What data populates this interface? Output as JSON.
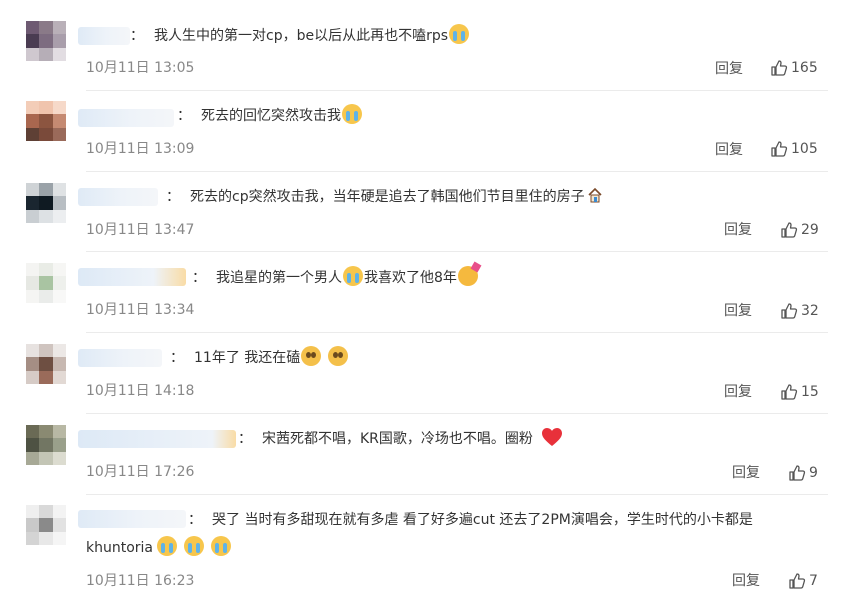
{
  "comments": [
    {
      "text": "我人生中的第一对cp，be以后从此再也不嗑rps",
      "time": "10月11日 13:05",
      "reply_label": "回复",
      "likes": "165"
    },
    {
      "text": "死去的回忆突然攻击我",
      "time": "10月11日 13:09",
      "reply_label": "回复",
      "likes": "105"
    },
    {
      "text": "死去的cp突然攻击我，当年硬是追去了韩国他们节目里住的房子",
      "time": "10月11日 13:47",
      "reply_label": "回复",
      "likes": "29"
    },
    {
      "text_a": "我追星的第一个男人",
      "text_b": "我喜欢了他8年",
      "time": "10月11日 13:34",
      "reply_label": "回复",
      "likes": "32"
    },
    {
      "text": "11年了 我还在磕",
      "time": "10月11日 14:18",
      "reply_label": "回复",
      "likes": "15"
    },
    {
      "text": "宋茜死都不唱，KR国歌，冷场也不唱。圈粉",
      "time": "10月11日 17:26",
      "reply_label": "回复",
      "likes": "9"
    },
    {
      "text": "哭了 当时有多甜现在就有多虐 看了好多遍cut 还去了2PM演唱会，学生时代的小卡都是",
      "text_cont": "khuntoria",
      "time": "10月11日 16:23",
      "reply_label": "回复",
      "likes": "7"
    }
  ],
  "colon": "：",
  "icons": {
    "like": "thumbs-up-icon",
    "cry": "loudly-crying-face-icon",
    "plead": "pleading-face-icon",
    "party": "partying-face-icon",
    "heart": "red-heart-icon",
    "house": "house-icon"
  }
}
